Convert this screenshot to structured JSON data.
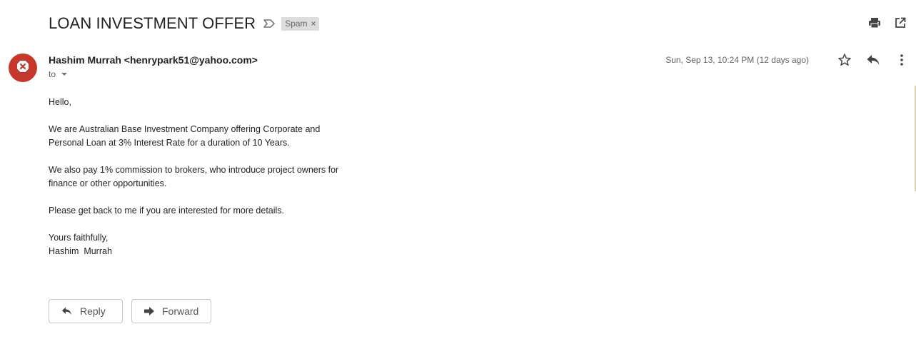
{
  "email": {
    "subject": "LOAN INVESTMENT OFFER",
    "label_chip": "Spam",
    "label_chip_remove": "×",
    "sender_display": "Hashim Murrah <henrypark51@yahoo.com>",
    "to_label": "to",
    "date": "Sun, Sep 13, 10:24 PM (12 days ago)",
    "body_lines": {
      "greeting": "Hello,",
      "p1_line1": "We are Australian Base Investment Company offering Corporate and",
      "p1_line2": "Personal Loan at 3% Interest Rate for a duration of 10 Years.",
      "p2_line1": "We also pay 1% commission to brokers, who introduce project owners for",
      "p2_line2": "finance or other opportunities.",
      "p3": "Please get back to me if you are interested for more details.",
      "closing": "Yours faithfully,",
      "signature": "Hashim  Murrah"
    }
  },
  "actions": {
    "reply_label": "Reply",
    "forward_label": "Forward"
  },
  "icons": {
    "label_arrow": "label-arrow-icon",
    "print": "print-icon",
    "open_new_window": "open-in-new-window-icon",
    "star": "star-icon",
    "reply": "reply-icon",
    "more": "more-vert-icon",
    "avatar": "blocked-sender-avatar-icon",
    "forward": "forward-icon"
  },
  "colors": {
    "avatar_bg": "#c5372c",
    "chip_bg": "#dddddd",
    "text": "#222222",
    "muted": "#5f6368"
  }
}
